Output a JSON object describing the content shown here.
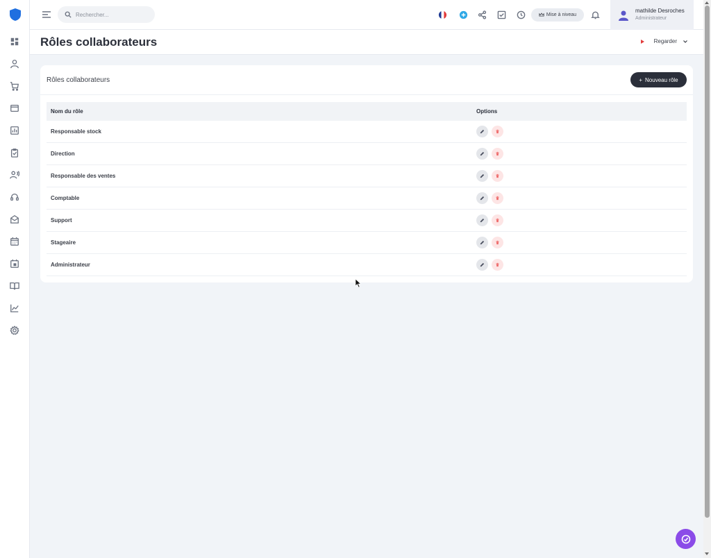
{
  "colors": {
    "brand": "#1f6fe0",
    "accent_dark": "#2b2f3a",
    "delete": "#ee6b6b",
    "chat": "#8b4be8"
  },
  "sidebar": {
    "icons": [
      "logo-icon",
      "dashboard-icon",
      "user-icon",
      "cart-icon",
      "wallet-icon",
      "chart-icon",
      "clipboard-check-icon",
      "users-icon",
      "headset-icon",
      "mail-icon",
      "calendar-icon",
      "calendar-event-icon",
      "book-icon",
      "trend-icon",
      "settings-icon"
    ]
  },
  "topbar": {
    "search_placeholder": "Rechercher...",
    "upgrade_label": "Mise à niveau",
    "user_name": "mathilde Desroches",
    "user_role": "Administrateur"
  },
  "page": {
    "title": "Rôles collaborateurs",
    "watch_label": "Regarder"
  },
  "card": {
    "title": "Rôles collaborateurs",
    "new_role_label": "Nouveau rôle",
    "columns": {
      "name": "Nom du rôle",
      "options": "Options"
    },
    "rows": [
      {
        "name": "Responsable stock"
      },
      {
        "name": "Direction"
      },
      {
        "name": "Responsable des ventes"
      },
      {
        "name": "Comptable"
      },
      {
        "name": "Support"
      },
      {
        "name": "Stageaire"
      },
      {
        "name": "Administrateur"
      }
    ]
  }
}
